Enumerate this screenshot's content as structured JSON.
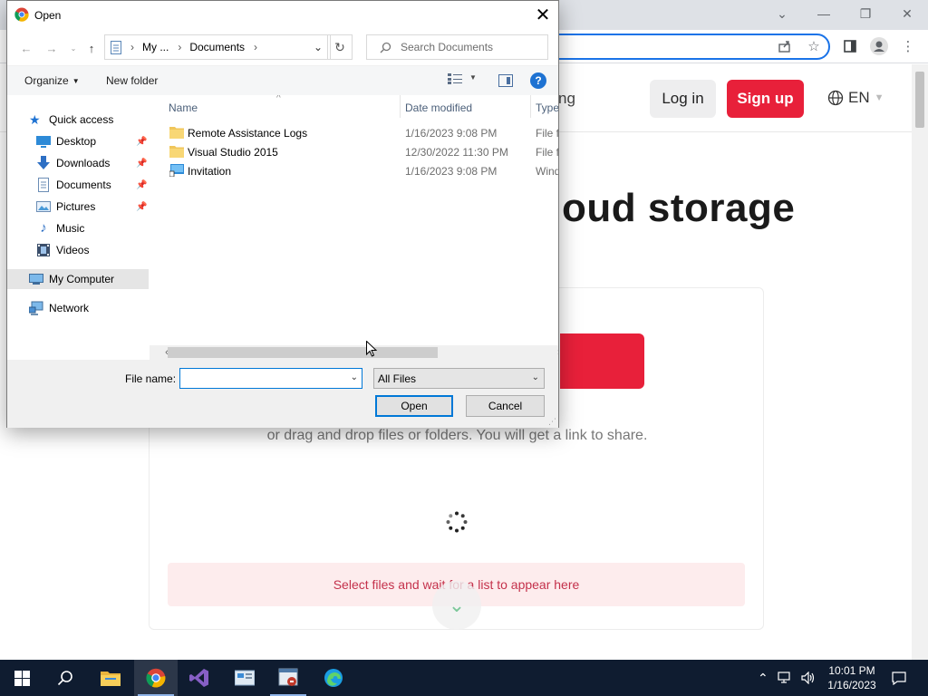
{
  "browser": {
    "window_controls": {
      "minimize": "—",
      "restore": "❐",
      "close": "✕"
    },
    "website": {
      "nav_partial": "ng",
      "login_label": "Log in",
      "signup_label": "Sign up",
      "language": "EN",
      "hero_title_partial": "oud storage",
      "drag_text": "or drag and drop files or folders. You will get a link to share.",
      "info_text": "Select files and wait for a list to appear here"
    }
  },
  "dialog": {
    "title": "Open",
    "address": {
      "segment_1": "My ...",
      "segment_2": "Documents"
    },
    "search_placeholder": "Search Documents",
    "commands": {
      "organize": "Organize",
      "new_folder": "New folder"
    },
    "nav_pane": [
      {
        "label": "Quick access",
        "icon": "star-icon",
        "pinned": false
      },
      {
        "label": "Desktop",
        "icon": "desktop-icon",
        "pinned": true
      },
      {
        "label": "Downloads",
        "icon": "download-icon",
        "pinned": true
      },
      {
        "label": "Documents",
        "icon": "documents-icon",
        "pinned": true
      },
      {
        "label": "Pictures",
        "icon": "pictures-icon",
        "pinned": true
      },
      {
        "label": "Music",
        "icon": "music-icon",
        "pinned": false
      },
      {
        "label": "Videos",
        "icon": "videos-icon",
        "pinned": false
      },
      {
        "label": "My Computer",
        "icon": "computer-icon",
        "pinned": false,
        "selected": true
      },
      {
        "label": "Network",
        "icon": "network-icon",
        "pinned": false
      }
    ],
    "columns": {
      "name": "Name",
      "date": "Date modified",
      "type": "Type"
    },
    "files": [
      {
        "name": "Remote Assistance Logs",
        "date": "1/16/2023 9:08 PM",
        "type": "File fo",
        "icon": "folder-icon"
      },
      {
        "name": "Visual Studio 2015",
        "date": "12/30/2022 11:30 PM",
        "type": "File fo",
        "icon": "folder-icon"
      },
      {
        "name": "Invitation",
        "date": "1/16/2023 9:08 PM",
        "type": "Wind",
        "icon": "shortcut-icon"
      }
    ],
    "file_name_label": "File name:",
    "file_name_value": "",
    "filter_value": "All Files",
    "open_label": "Open",
    "cancel_label": "Cancel"
  },
  "taskbar": {
    "time": "10:01 PM",
    "date": "1/16/2023"
  },
  "colors": {
    "accent": "#e8203a",
    "focus": "#0078d7",
    "taskbar": "#0f1c30"
  }
}
